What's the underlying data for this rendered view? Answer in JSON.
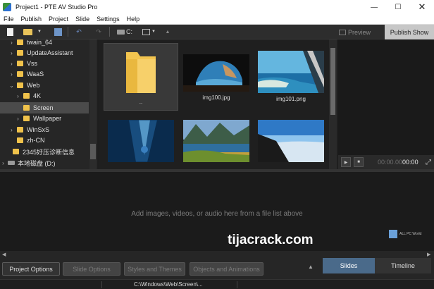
{
  "window": {
    "title": "Project1 - PTE AV Studio Pro",
    "minimize": "—",
    "maximize": "☐",
    "close": "✕"
  },
  "menu": [
    "File",
    "Publish",
    "Project",
    "Slide",
    "Settings",
    "Help"
  ],
  "toolbar": {
    "drive_label": "C:",
    "preview_label": "Preview",
    "publish_label": "Publish Show"
  },
  "tree": {
    "items": [
      {
        "label": "twain_64",
        "expanded": false
      },
      {
        "label": "UpdateAssistant",
        "expanded": false
      },
      {
        "label": "Vss",
        "expanded": false
      },
      {
        "label": "WaaS",
        "expanded": false
      },
      {
        "label": "Web",
        "expanded": true
      },
      {
        "label": "4K",
        "expanded": false
      },
      {
        "label": "Screen",
        "expanded": false,
        "selected": true
      },
      {
        "label": "Wallpaper",
        "expanded": false
      },
      {
        "label": "WinSxS",
        "expanded": false
      },
      {
        "label": "zh-CN",
        "expanded": false
      },
      {
        "label": "2345好压诊断信息",
        "expanded": false
      },
      {
        "label": "本地磁盘 (D:)",
        "expanded": false
      }
    ]
  },
  "thumbs": [
    {
      "label": "..",
      "kind": "folder-up"
    },
    {
      "label": "img100.jpg",
      "kind": "image"
    },
    {
      "label": "img101.png",
      "kind": "image"
    },
    {
      "label": "",
      "kind": "image"
    },
    {
      "label": "",
      "kind": "image"
    },
    {
      "label": "",
      "kind": "image"
    }
  ],
  "player": {
    "timecode_dim": "00:00.00",
    "timecode_bright": "00:00",
    "play": "▶",
    "stop": "■",
    "fullscreen": "⤢"
  },
  "slides": {
    "empty_hint": "Add images, videos, or audio here from a file list above"
  },
  "watermark": {
    "text": "tijacrack.com",
    "logo_text": "ALL PC World"
  },
  "bottom": {
    "project_options": "Project Options",
    "slide_options": "Slide Options",
    "styles_themes": "Styles and Themes",
    "objects_animations": "Objects and Animations",
    "tab_slides": "Slides",
    "tab_timeline": "Timeline"
  },
  "status": {
    "path": "C:\\Windows\\Web\\Screen\\..."
  },
  "colors": {
    "accent_tab": "#4a6a8a",
    "folder": "#f0c24b",
    "publish_bg": "#c7c7c7"
  }
}
